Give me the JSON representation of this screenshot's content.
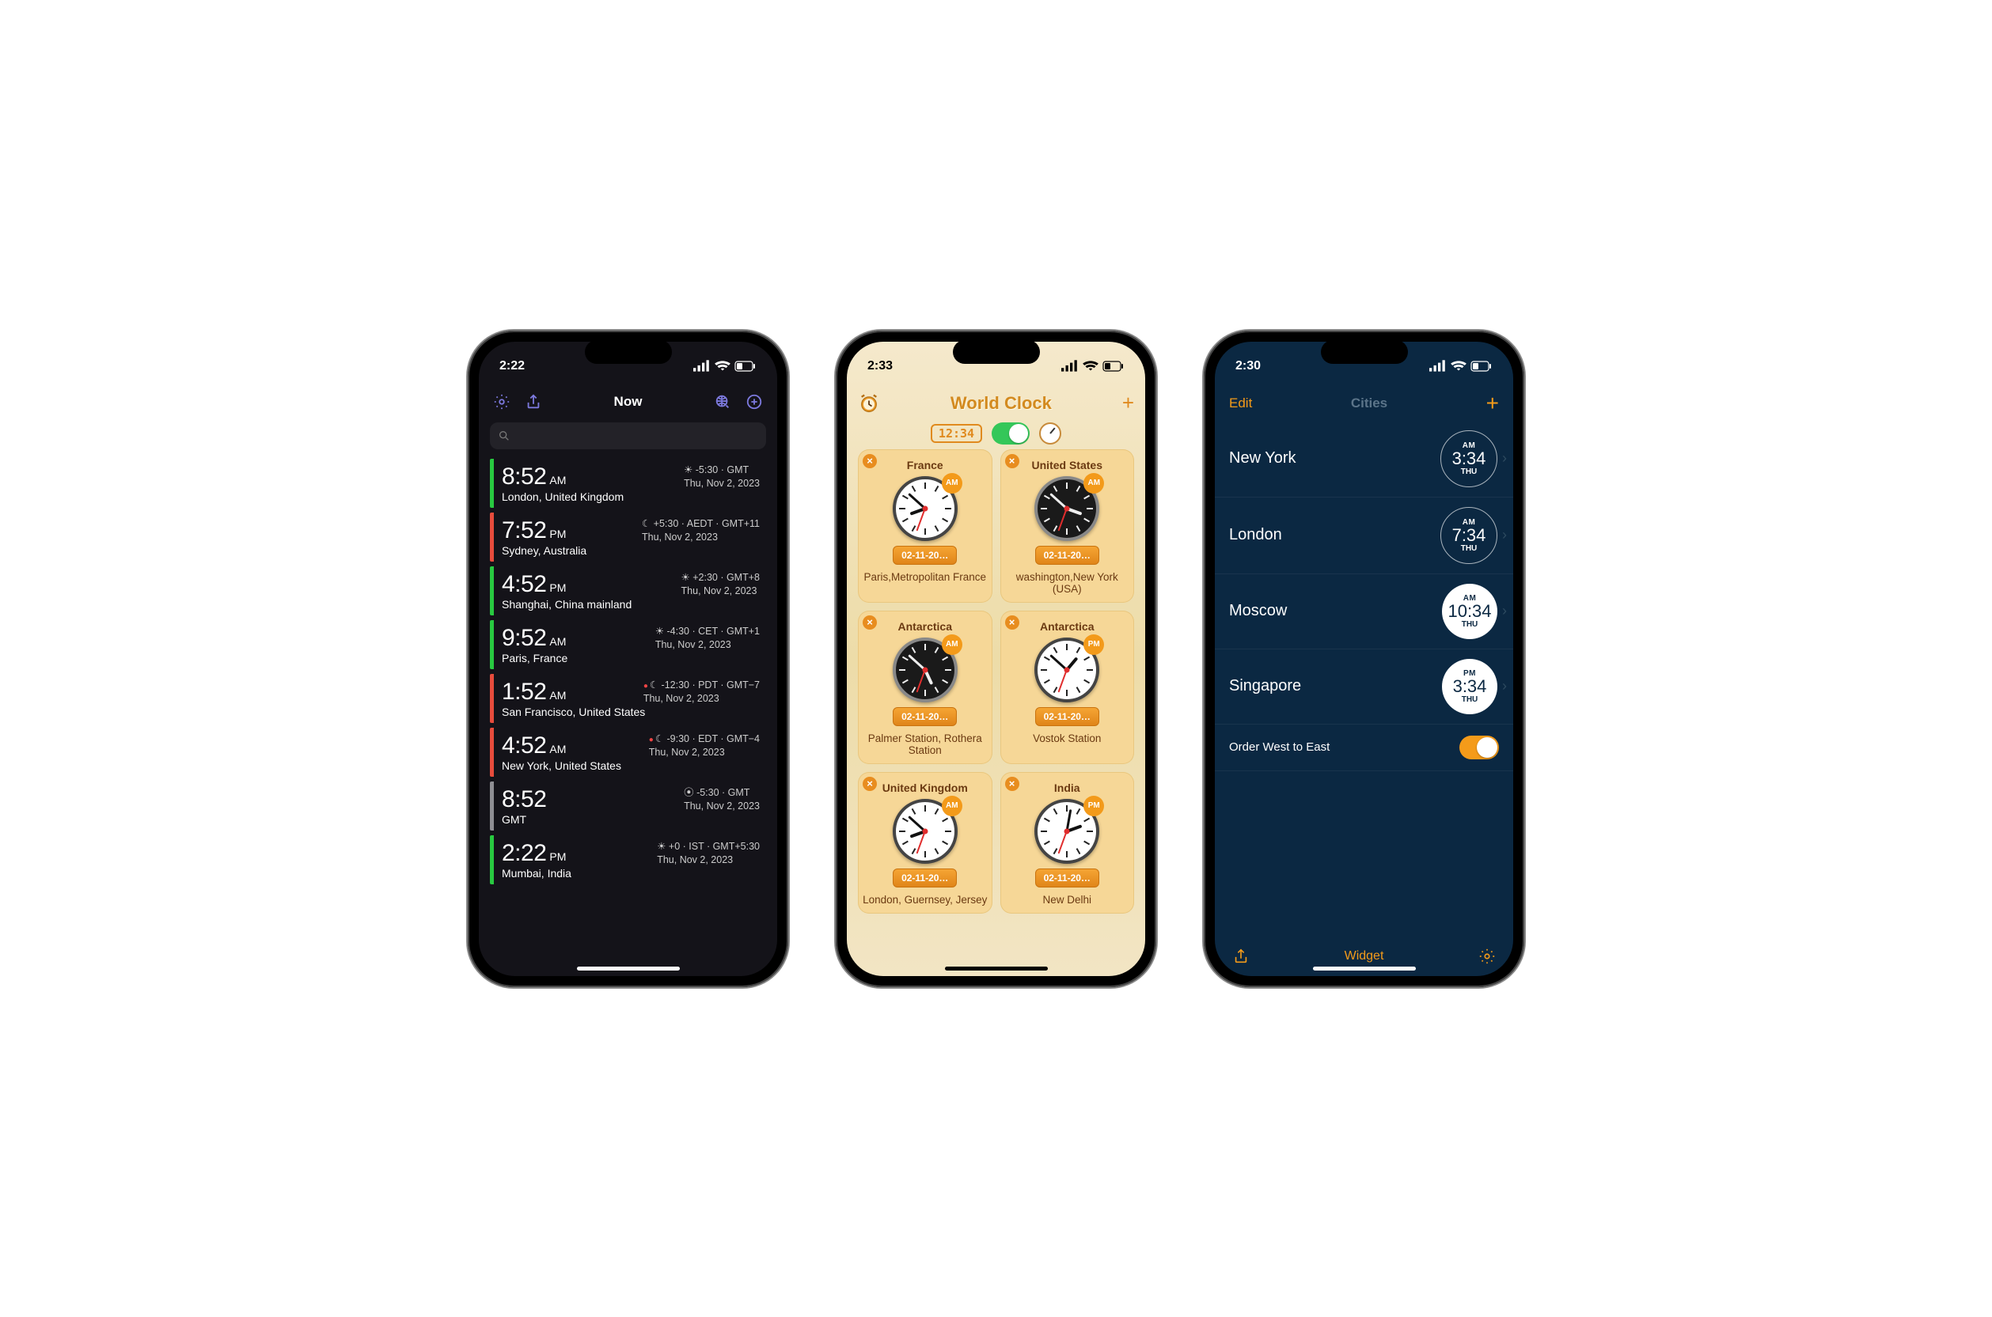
{
  "phone1": {
    "statusTime": "2:22",
    "title": "Now",
    "rows": [
      {
        "time": "8:52",
        "ampm": "AM",
        "offset": "☀ -5:30 · GMT",
        "date": "Thu, Nov 2, 2023",
        "loc": "London, United Kingdom",
        "color": "#28c940",
        "dot": false
      },
      {
        "time": "7:52",
        "ampm": "PM",
        "offset": "☾ +5:30 · AEDT · GMT+11",
        "date": "Thu, Nov 2, 2023",
        "loc": "Sydney, Australia",
        "color": "#e74c3c",
        "dot": false
      },
      {
        "time": "4:52",
        "ampm": "PM",
        "offset": "☀ +2:30 · GMT+8",
        "date": "Thu, Nov 2, 2023",
        "loc": "Shanghai, China mainland",
        "color": "#28c940",
        "dot": false
      },
      {
        "time": "9:52",
        "ampm": "AM",
        "offset": "☀ -4:30 · CET · GMT+1",
        "date": "Thu, Nov 2, 2023",
        "loc": "Paris, France",
        "color": "#28c940",
        "dot": false
      },
      {
        "time": "1:52",
        "ampm": "AM",
        "offset": "☾ -12:30 · PDT · GMT−7",
        "date": "Thu, Nov 2, 2023",
        "loc": "San Francisco, United States",
        "color": "#e74c3c",
        "dot": true
      },
      {
        "time": "4:52",
        "ampm": "AM",
        "offset": "☾ -9:30 · EDT · GMT−4",
        "date": "Thu, Nov 2, 2023",
        "loc": "New York, United States",
        "color": "#e74c3c",
        "dot": true
      },
      {
        "time": "8:52",
        "ampm": "",
        "offset": "⦿ -5:30 · GMT",
        "date": "Thu, Nov 2, 2023",
        "loc": "GMT",
        "color": "#8e8e93",
        "dot": false
      },
      {
        "time": "2:22",
        "ampm": "PM",
        "offset": "☀ +0 · IST · GMT+5:30",
        "date": "Thu, Nov 2, 2023",
        "loc": "Mumbai, India",
        "color": "#28c940",
        "dot": false
      }
    ]
  },
  "phone2": {
    "statusTime": "2:33",
    "title": "World Clock",
    "digitalBadge": "12:34",
    "cards": [
      {
        "country": "France",
        "place": "Paris,Metropolitan France",
        "date": "02-11-20…",
        "ampm": "AM",
        "face": "white",
        "hr": 250,
        "mn": 312
      },
      {
        "country": "United States",
        "place": "washington,New York (USA)",
        "date": "02-11-20…",
        "ampm": "AM",
        "face": "black",
        "hr": 110,
        "mn": 312
      },
      {
        "country": "Antarctica",
        "place": "Palmer Station, Rothera Station",
        "date": "02-11-20…",
        "ampm": "AM",
        "face": "black",
        "hr": 155,
        "mn": 312
      },
      {
        "country": "Antarctica",
        "place": "Vostok Station",
        "date": "02-11-20…",
        "ampm": "PM",
        "face": "white",
        "hr": 40,
        "mn": 312
      },
      {
        "country": "United Kingdom",
        "place": "London, Guernsey, Jersey",
        "date": "02-11-20…",
        "ampm": "AM",
        "face": "white",
        "hr": 250,
        "mn": 312
      },
      {
        "country": "India",
        "place": "New Delhi",
        "date": "02-11-20…",
        "ampm": "PM",
        "face": "white",
        "hr": 70,
        "mn": 10
      }
    ]
  },
  "phone3": {
    "statusTime": "2:30",
    "editLabel": "Edit",
    "title": "Cities",
    "cities": [
      {
        "name": "New York",
        "ampm": "AM",
        "time": "3:34",
        "day": "THU",
        "style": "outline"
      },
      {
        "name": "London",
        "ampm": "AM",
        "time": "7:34",
        "day": "THU",
        "style": "outline"
      },
      {
        "name": "Moscow",
        "ampm": "AM",
        "time": "10:34",
        "day": "THU",
        "style": "solid"
      },
      {
        "name": "Singapore",
        "ampm": "PM",
        "time": "3:34",
        "day": "THU",
        "style": "solid"
      }
    ],
    "orderLabel": "Order West to East",
    "widgetLabel": "Widget"
  }
}
